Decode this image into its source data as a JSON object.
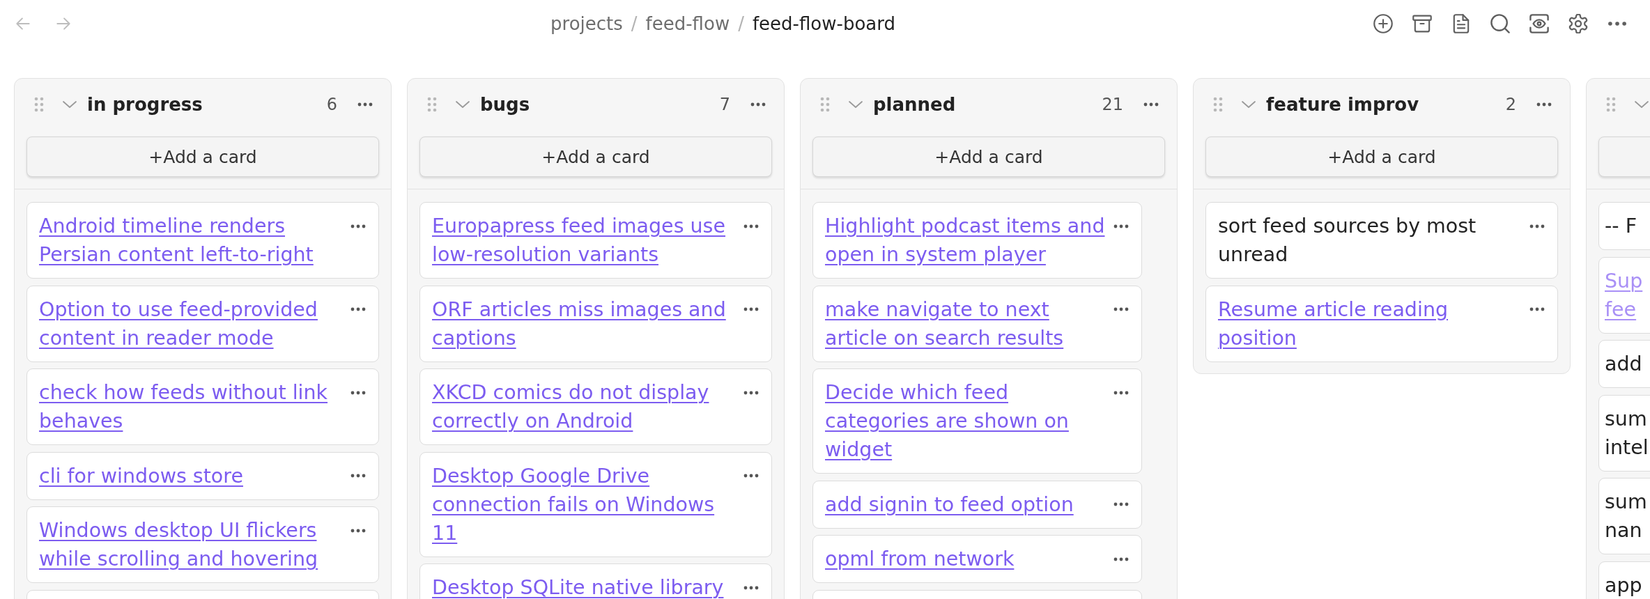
{
  "nav": [
    {
      "kind": "back",
      "disabled": true
    },
    {
      "kind": "forward",
      "disabled": true
    }
  ],
  "breadcrumb": [
    {
      "label": "projects",
      "current": false,
      "separator": "/"
    },
    {
      "label": "feed-flow",
      "current": false,
      "separator": "/"
    },
    {
      "label": "feed-flow-board",
      "current": true
    }
  ],
  "toolbar": [
    {
      "kind": "new"
    },
    {
      "kind": "archive"
    },
    {
      "kind": "note"
    },
    {
      "kind": "search"
    },
    {
      "kind": "preview"
    },
    {
      "kind": "settings"
    },
    {
      "kind": "more"
    }
  ],
  "columns": [
    {
      "title": "in progress",
      "count": "6",
      "expanded": true,
      "scrollable": false,
      "clipped": false,
      "add_label": "+Add a card",
      "cards": [
        {
          "kind": "link",
          "title": "Android timeline renders Persian content left-to-right"
        },
        {
          "kind": "link",
          "title": "Option to use feed-provided content in reader mode"
        },
        {
          "kind": "link",
          "title": "check how feeds without link behaves"
        },
        {
          "kind": "link",
          "title": "cli for windows store"
        },
        {
          "kind": "link",
          "title": "Windows desktop UI flickers while scrolling and hovering"
        },
        {
          "kind": "cut"
        }
      ]
    },
    {
      "title": "bugs",
      "count": "7",
      "expanded": true,
      "scrollable": false,
      "clipped": false,
      "add_label": "+Add a card",
      "cards": [
        {
          "kind": "link",
          "title": "Europapress feed images use low-resolution variants"
        },
        {
          "kind": "link",
          "title": "ORF articles miss images and captions"
        },
        {
          "kind": "link",
          "title": "XKCD comics do not display correctly on Android"
        },
        {
          "kind": "link",
          "title": "Desktop Google Drive connection fails on Windows 11"
        },
        {
          "kind": "link",
          "title": "Desktop SQLite native library"
        }
      ]
    },
    {
      "title": "planned",
      "count": "21",
      "expanded": true,
      "scrollable": true,
      "clipped": false,
      "add_label": "+Add a card",
      "cards": [
        {
          "kind": "link",
          "title": "Highlight podcast items and open in system player"
        },
        {
          "kind": "link",
          "title": "make navigate to next article on search results"
        },
        {
          "kind": "link",
          "title": "Decide which feed categories are shown on widget"
        },
        {
          "kind": "link",
          "title": "add signin to feed option"
        },
        {
          "kind": "link",
          "title": "opml from network"
        },
        {
          "kind": "cut"
        }
      ]
    },
    {
      "title": "feature improv",
      "count": "2",
      "expanded": true,
      "scrollable": false,
      "clipped": false,
      "add_label": "+Add a card",
      "cards": [
        {
          "kind": "text",
          "title": "sort feed sources by most unread"
        },
        {
          "kind": "link",
          "title": "Resume article reading position"
        }
      ]
    },
    {
      "expanded": true,
      "scrollable": false,
      "clipped": true,
      "cards": [
        {
          "kind": "text",
          "title": "-- F"
        },
        {
          "kind": "unresolved-link",
          "title": "Sup\nfee"
        },
        {
          "kind": "text",
          "title": "add"
        },
        {
          "kind": "text",
          "title": "sum\nintel"
        },
        {
          "kind": "text",
          "title": "sum\nnan"
        },
        {
          "kind": "text",
          "title": "app"
        }
      ]
    }
  ]
}
